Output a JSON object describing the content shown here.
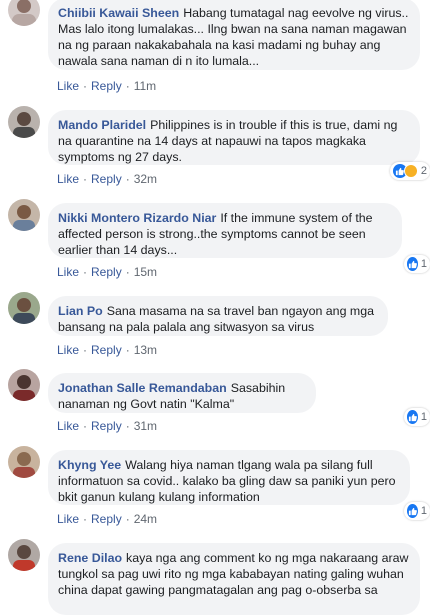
{
  "comments": [
    {
      "author": "Chiibii Kawaii Sheen",
      "text": "Habang tumatagal nag eevolve ng virus.. Mas lalo itong lumalakas... Ilng bwan na sana naman magawan na ng paraan nakakabahala na kasi madami ng buhay ang nawala sana naman di n ito lumala...",
      "like": "Like",
      "reply": "Reply",
      "time": "11m",
      "reaction_count": ""
    },
    {
      "author": "Mando Plaridel",
      "text": "Philippines is in trouble if this is true, dami ng na quarantine na 14 days at napauwi na tapos magkaka symptoms ng 27 days.",
      "like": "Like",
      "reply": "Reply",
      "time": "32m",
      "reaction_count": "2"
    },
    {
      "author": "Nikki Montero Rizardo Niar",
      "text": "If the immune system of the affected person is strong..the symptoms cannot be seen earlier than 14 days...",
      "like": "Like",
      "reply": "Reply",
      "time": "15m",
      "reaction_count": "1"
    },
    {
      "author": "Lian Po",
      "text": "Sana masama na sa travel ban ngayon ang mga bansang na pala palala ang sitwasyon sa virus",
      "like": "Like",
      "reply": "Reply",
      "time": "13m",
      "reaction_count": ""
    },
    {
      "author": "Jonathan Salle Remandaban",
      "text": "Sasabihin nanaman ng Govt natin \"Kalma\"",
      "like": "Like",
      "reply": "Reply",
      "time": "31m",
      "reaction_count": "1"
    },
    {
      "author": "Khyng Yee",
      "text": "Walang hiya naman tlgang wala pa silang full informatuon sa covid.. kalako ba gling daw sa paniki yun pero bkit ganun kulang kulang information",
      "like": "Like",
      "reply": "Reply",
      "time": "24m",
      "reaction_count": "1"
    },
    {
      "author": "Rene Dilao",
      "text": "kaya nga ang comment ko ng mga nakaraang araw tungkol sa pag uwi rito ng mga kababayan nating galing wuhan china dapat gawing pangmatagalan ang pag o-obserba sa",
      "like": "Like",
      "reply": "Reply",
      "time": "",
      "reaction_count": ""
    }
  ],
  "colors": {
    "author": "#385898",
    "bubble": "#f2f3f5",
    "like_icon": "#1877f2",
    "sad_icon": "#f7b125"
  }
}
